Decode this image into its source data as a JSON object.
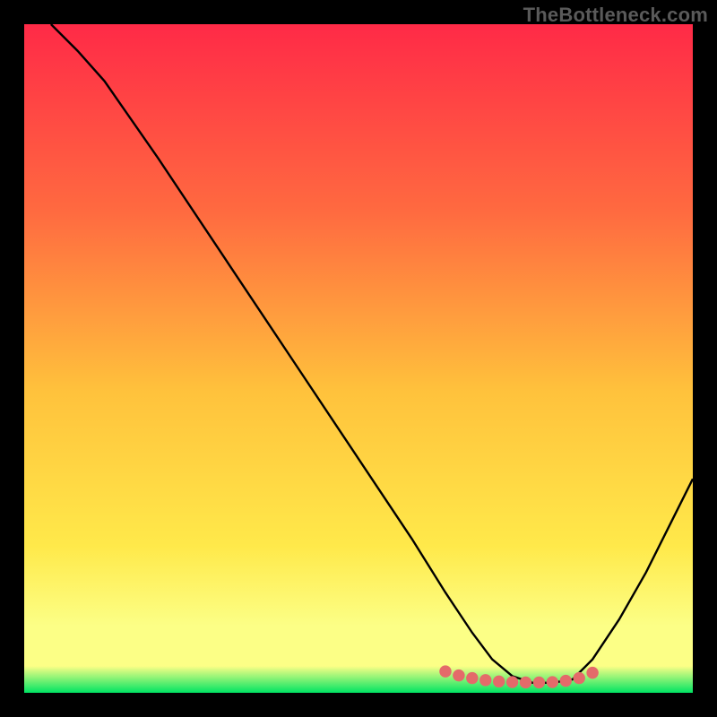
{
  "watermark": "TheBottleneck.com",
  "colors": {
    "background": "#000000",
    "gradient_top": "#ff2a47",
    "gradient_mid_upper": "#ff6a40",
    "gradient_mid": "#ffc23c",
    "gradient_mid_lower": "#ffe94a",
    "gradient_low": "#fcff86",
    "gradient_bottom": "#00e463",
    "curve": "#000000",
    "marker": "#e46a6a"
  },
  "chart_data": {
    "type": "line",
    "title": "",
    "xlabel": "",
    "ylabel": "",
    "xlim": [
      0,
      100
    ],
    "ylim": [
      0,
      100
    ],
    "series": [
      {
        "name": "bottleneck-curve",
        "x": [
          4,
          8,
          12,
          20,
          30,
          40,
          50,
          58,
          63,
          67,
          70,
          73,
          76,
          79,
          82,
          85,
          89,
          93,
          97,
          100
        ],
        "y": [
          100,
          96,
          91.5,
          80,
          65,
          50,
          35,
          23,
          15,
          9,
          5,
          2.5,
          1.5,
          1.5,
          2,
          5,
          11,
          18,
          26,
          32
        ]
      }
    ],
    "markers": {
      "name": "highlight-dots",
      "x": [
        63,
        65,
        67,
        69,
        71,
        73,
        75,
        77,
        79,
        81,
        83,
        85
      ],
      "y": [
        3.2,
        2.6,
        2.2,
        1.9,
        1.7,
        1.6,
        1.55,
        1.55,
        1.6,
        1.8,
        2.2,
        3.0
      ]
    }
  }
}
